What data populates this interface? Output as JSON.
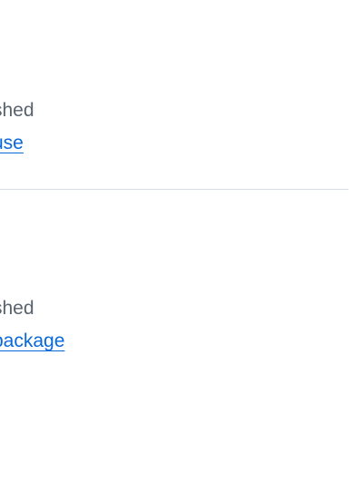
{
  "items": [
    {
      "status": "shed",
      "link_label": "use"
    },
    {
      "status": "shed",
      "link_label": "package"
    }
  ]
}
